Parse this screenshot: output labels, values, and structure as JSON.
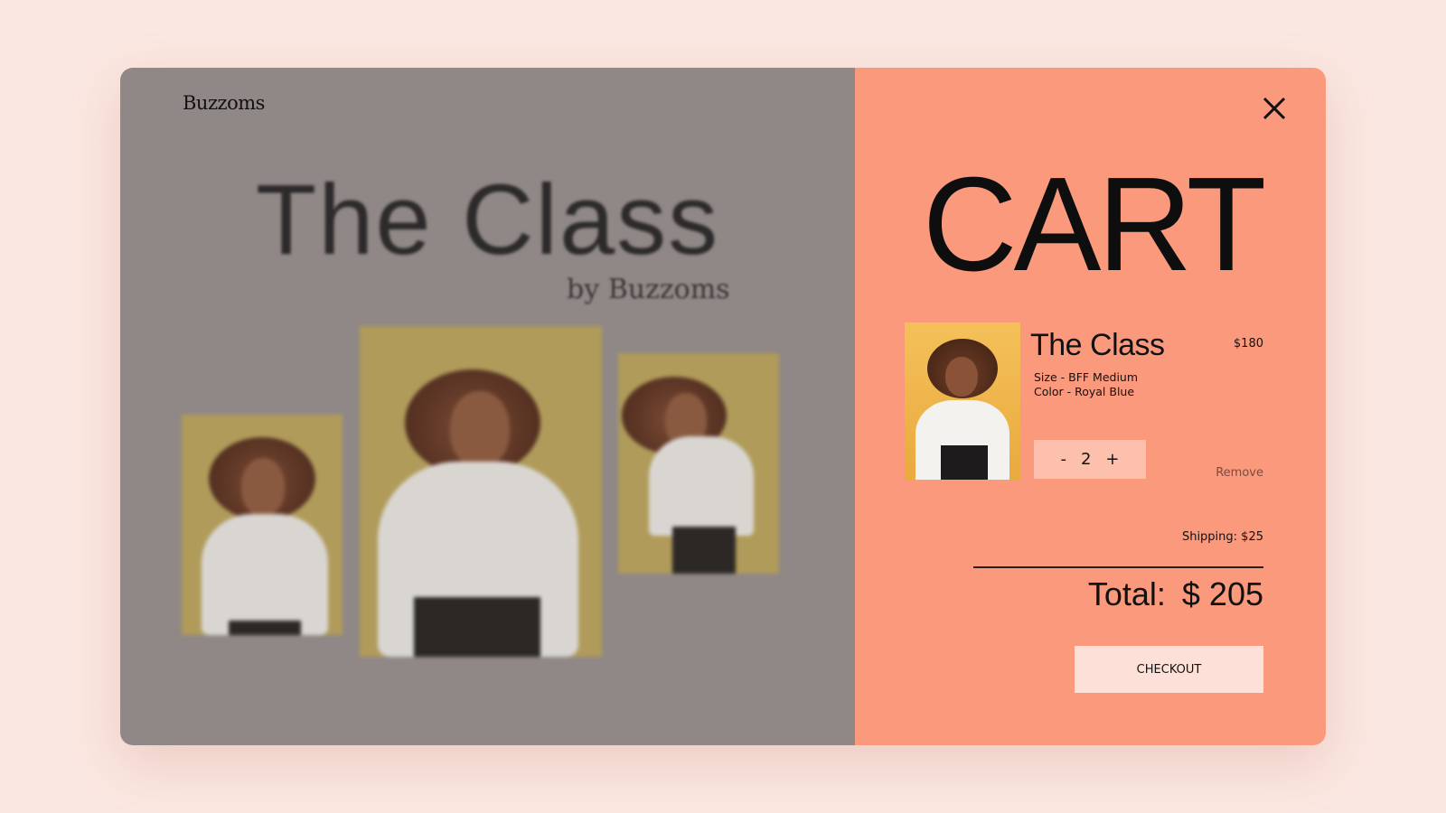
{
  "brand": "Buzzoms",
  "hero": {
    "title": "The Class",
    "subtitle": "by Buzzoms"
  },
  "cart": {
    "title": "CART",
    "close_icon": "close-icon",
    "item": {
      "name": "The Class",
      "price": "$180",
      "size": "Size - BFF Medium",
      "color": "Color - Royal Blue",
      "quantity": "2",
      "decrement": "-",
      "increment": "+",
      "remove_label": "Remove"
    },
    "shipping": "Shipping: $25",
    "total_label": "Total:",
    "total_value": "$ 205",
    "checkout_label": "CHECKOUT"
  },
  "colors": {
    "page_bg": "#fbe7e1",
    "overlay": "#908886",
    "cart_panel": "#fb997d",
    "qty_bg": "#fdc0ad",
    "checkout_bg": "#fde0d7"
  }
}
